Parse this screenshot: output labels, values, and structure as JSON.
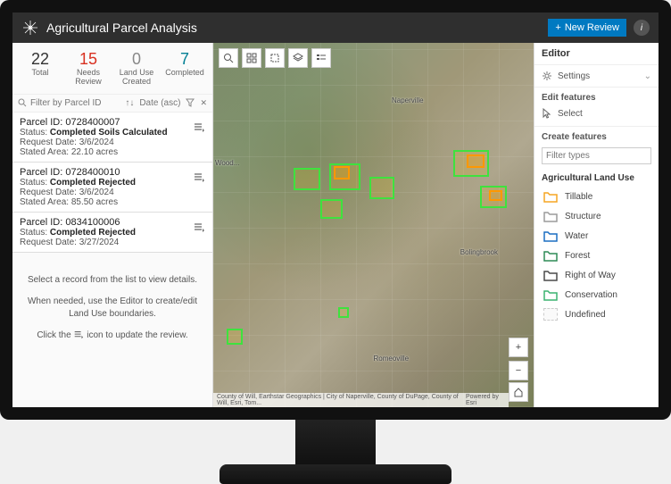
{
  "header": {
    "title": "Agricultural Parcel Analysis",
    "new_review_label": "New Review"
  },
  "stats": {
    "total": {
      "value": "22",
      "label": "Total"
    },
    "needs_review": {
      "value": "15",
      "label": "Needs Review"
    },
    "land_use": {
      "value": "0",
      "label": "Land Use Created"
    },
    "completed": {
      "value": "7",
      "label": "Completed"
    }
  },
  "filter": {
    "placeholder": "Filter by Parcel ID",
    "sort_label": "Date (asc)"
  },
  "records": [
    {
      "parcel_label": "Parcel ID: 0728400007",
      "status_prefix": "Status: ",
      "status": "Completed Soils Calculated",
      "date_label": "Request Date: 3/6/2024",
      "area_label": "Stated Area: 22.10 acres"
    },
    {
      "parcel_label": "Parcel ID: 0728400010",
      "status_prefix": "Status: ",
      "status": "Completed Rejected",
      "date_label": "Request Date: 3/6/2024",
      "area_label": "Stated Area: 85.50 acres"
    },
    {
      "parcel_label": "Parcel ID: 0834100006",
      "status_prefix": "Status: ",
      "status": "Completed Rejected",
      "date_label": "Request Date: 3/27/2024",
      "area_label": ""
    }
  ],
  "instructions": {
    "line1": "Select a record from the list to view details.",
    "line2": "When needed, use the Editor to create/edit Land Use boundaries.",
    "line3a": "Click the ",
    "line3b": " icon to update the review."
  },
  "map": {
    "attribution_left": "County of Will, Earthstar Geographics | City of Naperville, County of DuPage, County of Will, Esri, Tom...",
    "attribution_right": "Powered by Esri",
    "labels": {
      "naperville": "Naperville",
      "bolingbrook": "Bolingbrook",
      "romeoville": "Romeoville",
      "wood": "Wood..."
    }
  },
  "editor": {
    "title": "Editor",
    "settings": "Settings",
    "edit_label": "Edit features",
    "select_label": "Select",
    "create_label": "Create features",
    "filter_placeholder": "Filter types",
    "category": "Agricultural Land Use",
    "features": [
      {
        "name": "Tillable",
        "color": "#f5a623"
      },
      {
        "name": "Structure",
        "color": "#9b9b9b"
      },
      {
        "name": "Water",
        "color": "#1b6ec2"
      },
      {
        "name": "Forest",
        "color": "#2e8b57"
      },
      {
        "name": "Right of Way",
        "color": "#4a4a4a"
      },
      {
        "name": "Conservation",
        "color": "#3cb371"
      },
      {
        "name": "Undefined",
        "color": ""
      }
    ]
  }
}
